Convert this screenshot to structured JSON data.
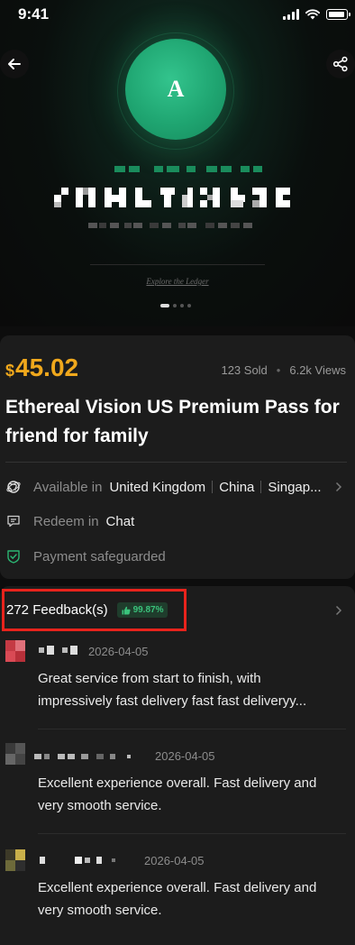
{
  "status_bar": {
    "time": "9:41"
  },
  "hero": {
    "logo_letter": "A",
    "explore_link": "Explore the Ledger"
  },
  "product": {
    "currency_symbol": "$",
    "price": "45.02",
    "sold": "123 Sold",
    "views": "6.2k Views",
    "stats_separator": "•",
    "title": "Ethereal Vision US Premium Pass for friend for family",
    "available_label": "Available in",
    "countries": [
      "United Kingdom",
      "China",
      "Singap..."
    ],
    "redeem_label": "Redeem in",
    "redeem_value": "Chat",
    "payment_label": "Payment safeguarded"
  },
  "feedback": {
    "count_label": "272 Feedback(s)",
    "rating": "99.87%",
    "reviews": [
      {
        "date": "2026-04-05",
        "text": "Great service from start to finish, with impressively fast delivery fast fast deliveryy..."
      },
      {
        "date": "2026-04-05",
        "text": "Excellent experience overall. Fast delivery and very smooth service."
      },
      {
        "date": "2026-04-05",
        "text": "Excellent experience overall. Fast delivery and very smooth service."
      }
    ]
  },
  "colors": {
    "accent": "#f0a81c",
    "brand_green": "#1fa571",
    "highlight_red": "#e8231c"
  },
  "icons": [
    "back-arrow-icon",
    "share-icon",
    "globe-icon",
    "chat-icon",
    "shield-check-icon",
    "thumbs-up-icon",
    "chevron-right-icon"
  ]
}
